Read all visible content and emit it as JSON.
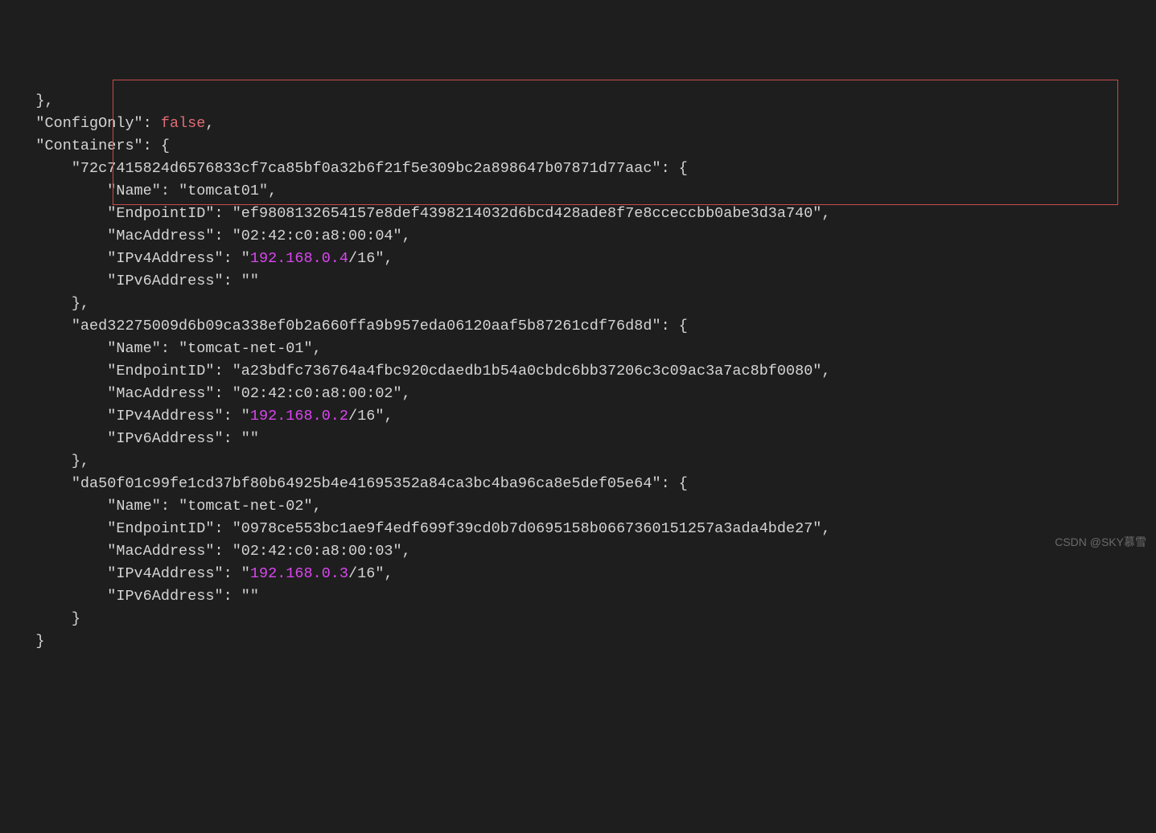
{
  "lines": {
    "l0": "},",
    "l1_k": "\"ConfigOnly\"",
    "l1_v": "false",
    "l2_k": "\"Containers\"",
    "c1_id": "\"72c7415824d6576833cf7ca85bf0a32b6f21f5e309bc2a898647b07871d77aac\"",
    "c1_name_k": "\"Name\"",
    "c1_name_v": "\"tomcat01\"",
    "c1_ep_k": "\"EndpointID\"",
    "c1_ep_v": "\"ef9808132654157e8def4398214032d6bcd428ade8f7e8cceccbb0abe3d3a740\"",
    "c1_mac_k": "\"MacAddress\"",
    "c1_mac_v": "\"02:42:c0:a8:00:04\"",
    "c1_ip4_k": "\"IPv4Address\"",
    "c1_ip4_pre": "\"",
    "c1_ip4_ip": "192.168.0.4",
    "c1_ip4_post": "/16\"",
    "c1_ip6_k": "\"IPv6Address\"",
    "c1_ip6_v": "\"\"",
    "c2_id": "\"aed32275009d6b09ca338ef0b2a660ffa9b957eda06120aaf5b87261cdf76d8d\"",
    "c2_name_k": "\"Name\"",
    "c2_name_v": "\"tomcat-net-01\"",
    "c2_ep_k": "\"EndpointID\"",
    "c2_ep_v": "\"a23bdfc736764a4fbc920cdaedb1b54a0cbdc6bb37206c3c09ac3a7ac8bf0080\"",
    "c2_mac_k": "\"MacAddress\"",
    "c2_mac_v": "\"02:42:c0:a8:00:02\"",
    "c2_ip4_k": "\"IPv4Address\"",
    "c2_ip4_pre": "\"",
    "c2_ip4_ip": "192.168.0.2",
    "c2_ip4_post": "/16\"",
    "c2_ip6_k": "\"IPv6Address\"",
    "c2_ip6_v": "\"\"",
    "c3_id": "\"da50f01c99fe1cd37bf80b64925b4e41695352a84ca3bc4ba96ca8e5def05e64\"",
    "c3_name_k": "\"Name\"",
    "c3_name_v": "\"tomcat-net-02\"",
    "c3_ep_k": "\"EndpointID\"",
    "c3_ep_v": "\"0978ce553bc1ae9f4edf699f39cd0b7d0695158b0667360151257a3ada4bde27\"",
    "c3_mac_k": "\"MacAddress\"",
    "c3_mac_v": "\"02:42:c0:a8:00:03\"",
    "c3_ip4_k": "\"IPv4Address\"",
    "c3_ip4_pre": "\"",
    "c3_ip4_ip": "192.168.0.3",
    "c3_ip4_post": "/16\"",
    "c3_ip6_k": "\"IPv6Address\"",
    "c3_ip6_v": "\"\"",
    "close_brace": "}",
    "close_brace_comma": "},"
  },
  "watermark": "CSDN @SKY慕雪"
}
